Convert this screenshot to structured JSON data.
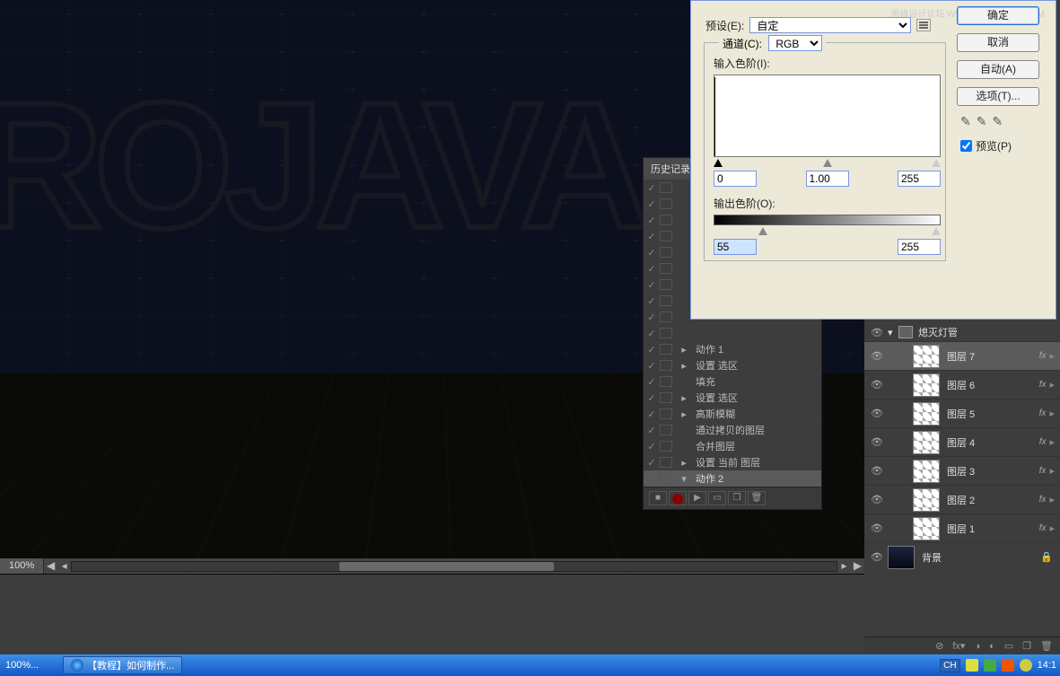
{
  "watermark": "思缘设计论坛  WWW.MISSYUAN.COM",
  "canvas": {
    "text": "ROJAVA",
    "zoom": "100%"
  },
  "history": {
    "title": "历史记录",
    "header": "动作 1",
    "items": [
      "设置 选区",
      "填充",
      "设置 选区",
      "高斯模糊",
      "通过拷贝的图层",
      "合并图层",
      "设置 当前 图层"
    ],
    "footer_label": "动作 2"
  },
  "layers": {
    "group": "熄灭灯管",
    "items": [
      {
        "name": "图层 7",
        "fx": "fx"
      },
      {
        "name": "图层 6",
        "fx": "fx"
      },
      {
        "name": "图层 5",
        "fx": "fx"
      },
      {
        "name": "图层 4",
        "fx": "fx"
      },
      {
        "name": "图层 3",
        "fx": "fx"
      },
      {
        "name": "图层 2",
        "fx": "fx"
      },
      {
        "name": "图层 1",
        "fx": "fx"
      }
    ],
    "background": "背景"
  },
  "levels": {
    "preset_label": "预设(E):",
    "preset_value": "自定",
    "channel_label_prefix": "通道(C):",
    "channel_value": "RGB",
    "input_label": "输入色阶(I):",
    "input_black": "0",
    "input_gamma": "1.00",
    "input_white": "255",
    "output_label": "输出色阶(O):",
    "output_black": "55",
    "output_white": "255",
    "ok": "确定",
    "cancel": "取消",
    "auto": "自动(A)",
    "options": "选项(T)...",
    "preview": "预览(P)"
  },
  "taskbar": {
    "ps_zoom": "100%...",
    "task_title": "【教程】如何制作...",
    "lang": "CH",
    "time": "14:1"
  }
}
